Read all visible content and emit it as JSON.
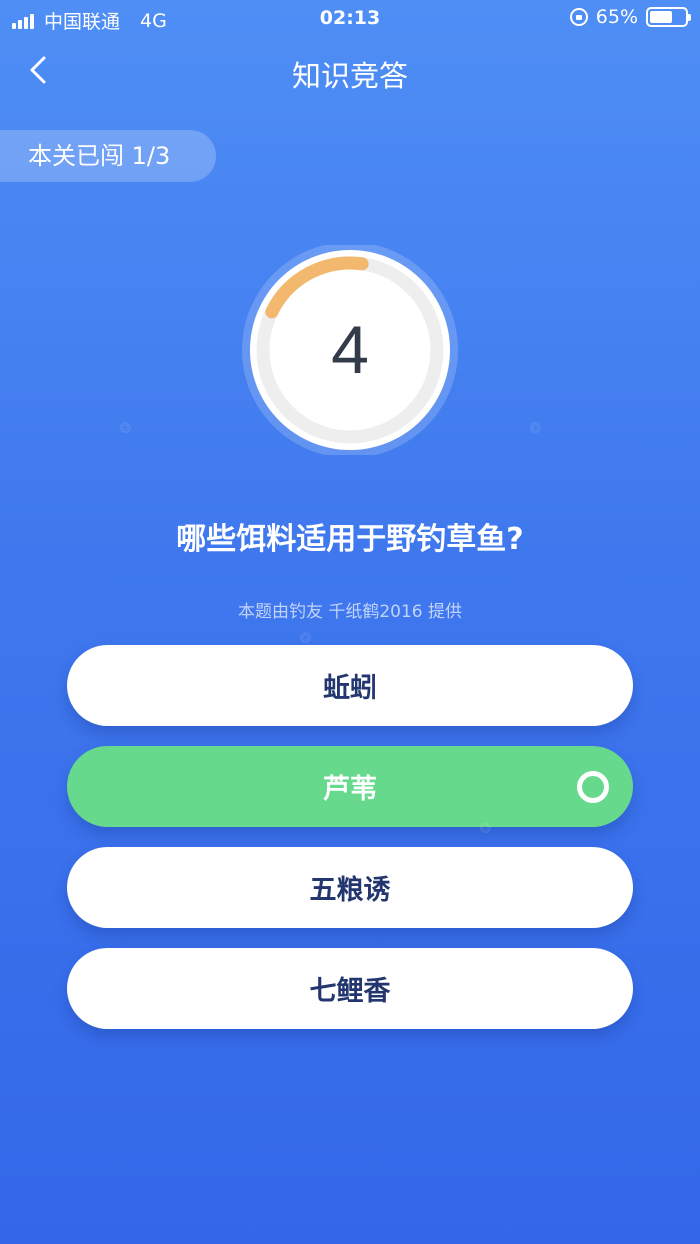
{
  "status_bar": {
    "carrier": "中国联通",
    "network": "4G",
    "time": "02:13",
    "battery": "65%",
    "battery_level": 0.65
  },
  "nav": {
    "title": "知识竞答",
    "back_icon": "chevron-left-icon"
  },
  "progress": {
    "label": "本关已闯 1/3"
  },
  "timer": {
    "value": "4",
    "fraction_remaining": 0.2,
    "arc_color": "#f2b86d"
  },
  "question": {
    "text": "哪些饵料适用于野钓草鱼?",
    "provider": "本题由钓友 千纸鹤2016 提供"
  },
  "options": [
    {
      "label": "蚯蚓",
      "selected": false
    },
    {
      "label": "芦苇",
      "selected": true
    },
    {
      "label": "五粮诱",
      "selected": false
    },
    {
      "label": "七鲤香",
      "selected": false
    }
  ],
  "colors": {
    "selected": "#67d98d",
    "option_text": "#23366f"
  }
}
